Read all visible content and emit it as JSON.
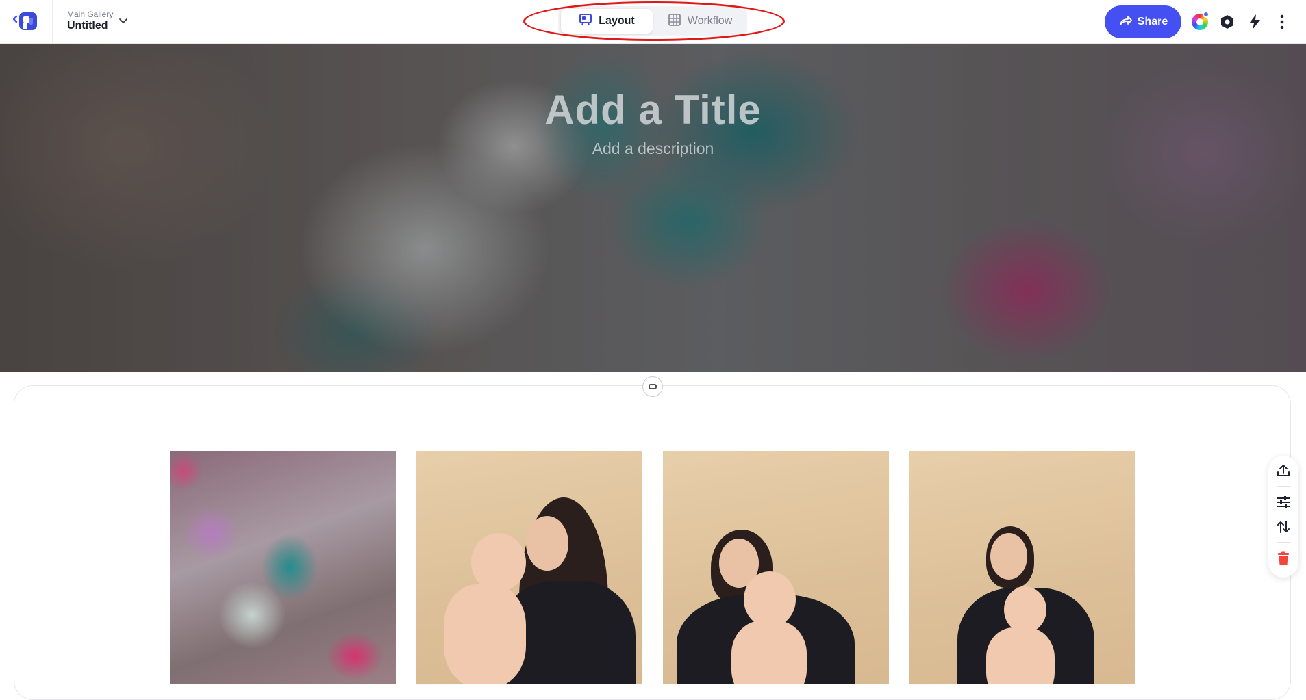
{
  "header": {
    "gallery_sub": "Main Gallery",
    "gallery_title": "Untitled",
    "modes": [
      {
        "label": "Layout",
        "icon": "layout-icon",
        "active": true
      },
      {
        "label": "Workflow",
        "icon": "grid-icon",
        "active": false
      }
    ],
    "share_label": "Share",
    "right_icons": [
      "color-wheel-icon",
      "hexagon-settings-icon",
      "lightning-icon",
      "more-vertical-icon"
    ]
  },
  "hero": {
    "title_placeholder": "Add a Title",
    "description_placeholder": "Add a description"
  },
  "gallery": {
    "photos": [
      {
        "subject": "teal and white flowers with pink blossoms"
      },
      {
        "subject": "mother holding smiling baby"
      },
      {
        "subject": "mother sitting with baby waving"
      },
      {
        "subject": "mother sitting with baby on lap"
      }
    ]
  },
  "rail": {
    "icons": [
      "upload-icon",
      "adjust-icon",
      "reorder-icon",
      "trash-icon"
    ]
  },
  "colors": {
    "accent": "#4450f2",
    "highlight_oval": "#e01818",
    "danger": "#f0463c"
  }
}
